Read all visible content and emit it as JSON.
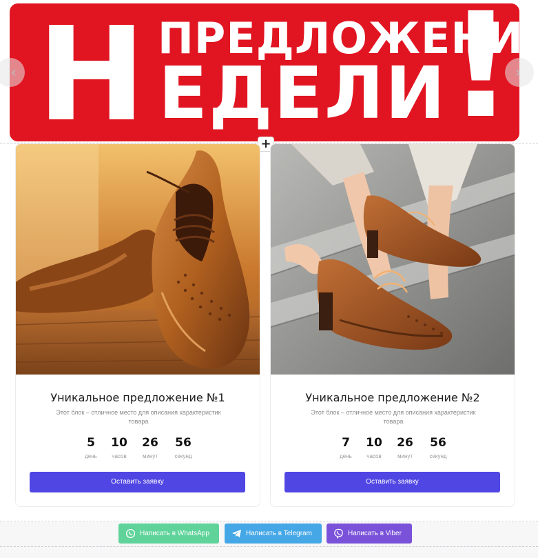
{
  "banner": {
    "line1": "ПРЕДЛОЖЕНИЕ",
    "big_letter": "Н",
    "line2": "ЕДЕЛИ",
    "exclamation": "!"
  },
  "slider": {
    "prev_icon": "chevron-left-icon",
    "next_icon": "chevron-right-icon",
    "prev_glyph": "‹",
    "next_glyph": "›"
  },
  "add_block": {
    "glyph": "+"
  },
  "cards": [
    {
      "title": "Уникальное предложение №1",
      "description": "Этот блок – отличное место для описания характеристик товара",
      "timer": [
        {
          "value": "5",
          "label": "день"
        },
        {
          "value": "10",
          "label": "часов"
        },
        {
          "value": "26",
          "label": "минут"
        },
        {
          "value": "56",
          "label": "секунд"
        }
      ],
      "button": "Оставить заявку"
    },
    {
      "title": "Уникальное предложение №2",
      "description": "Этот блок – отличное место для описания характеристик товара",
      "timer": [
        {
          "value": "7",
          "label": "день"
        },
        {
          "value": "10",
          "label": "часов"
        },
        {
          "value": "26",
          "label": "минут"
        },
        {
          "value": "56",
          "label": "секунд"
        }
      ],
      "button": "Оставить заявку"
    }
  ],
  "messengers": {
    "whatsapp": "Написать в WhatsApp",
    "telegram": "Написать в Telegram",
    "viber": "Написать в Viber"
  },
  "colors": {
    "banner_red": "#e11521",
    "accent_button": "#5046e4",
    "whatsapp": "#5fd39a",
    "telegram": "#45a7e6",
    "viber": "#7a52d9"
  }
}
